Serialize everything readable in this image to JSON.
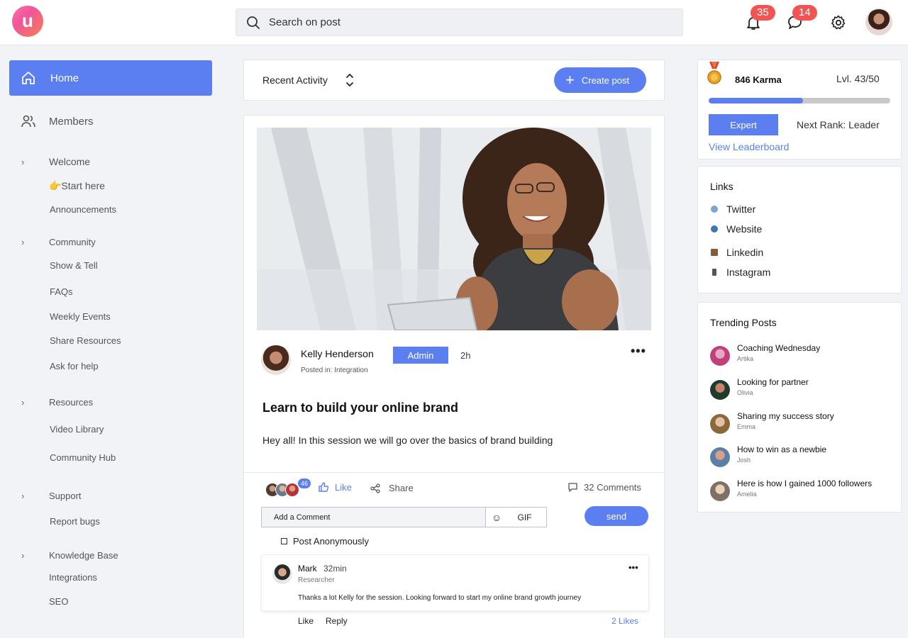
{
  "header": {
    "logo_letter": "u",
    "search_placeholder": "Search on post",
    "notifications_count": "35",
    "messages_count": "14"
  },
  "sidebar": {
    "home_label": "Home",
    "members_label": "Members",
    "groups": [
      {
        "label": "Welcome",
        "items": [
          "👉Start here",
          "Announcements"
        ]
      },
      {
        "label": "Community",
        "items": [
          "Show & Tell",
          "FAQs",
          "Weekly Events",
          "Share Resources",
          "Ask for help"
        ]
      },
      {
        "label": "Resources",
        "items": [
          "Video Library",
          "Community Hub"
        ]
      },
      {
        "label": "Support",
        "items": [
          "Report bugs"
        ]
      },
      {
        "label": "Knowledge Base",
        "items": [
          "Integrations",
          "SEO"
        ]
      }
    ]
  },
  "feed": {
    "activity_label": "Recent Activity",
    "create_post_label": "Create post"
  },
  "post": {
    "author_name": "Kelly Henderson",
    "author_badge": "Admin",
    "time": "2h",
    "posted_in": "Posted in: Integration",
    "title": "Learn to build your online brand",
    "body": "Hey all! In this session we will go over the basics of brand building",
    "reactors_count": "46",
    "like_label": "Like",
    "share_label": "Share",
    "comments_label": "32 Comments",
    "comment_placeholder": "Add a Comment",
    "gif_label": "GIF",
    "send_label": "send",
    "anonymous_label": "Post Anonymously"
  },
  "comment": {
    "name": "Mark",
    "time": "32min",
    "role": "Researcher",
    "text": "Thanks a lot Kelly for the session. Looking forward to start my online brand growth journey",
    "like_label": "Like",
    "reply_label": "Reply",
    "likes_count": "2 Likes"
  },
  "karma": {
    "label": "846 Karma",
    "level": "Lvl. 43/50",
    "progress": 0.52,
    "rank": "Expert",
    "next_rank": "Next Rank: Leader",
    "leaderboard_label": "View Leaderboard"
  },
  "links": {
    "title": "Links",
    "items": [
      {
        "label": "Twitter",
        "icon": "twitter-icon"
      },
      {
        "label": "Website",
        "icon": "globe-icon"
      },
      {
        "label": "Linkedin",
        "icon": "briefcase-icon"
      },
      {
        "label": "Instagram",
        "icon": "phone-icon"
      }
    ]
  },
  "trending": {
    "title": "Trending Posts",
    "items": [
      {
        "title": "Coaching Wednesday",
        "author": "Artika"
      },
      {
        "title": "Looking for partner",
        "author": "Olivia"
      },
      {
        "title": "Sharing my success story",
        "author": "Emma"
      },
      {
        "title": "How to win as a newbie",
        "author": "Josh"
      },
      {
        "title": "Here is how I gained 1000 followers",
        "author": "Amelia"
      }
    ]
  },
  "colors": {
    "accent": "#5b7ff0",
    "badge": "#f25454",
    "background": "#f2f3f6"
  }
}
